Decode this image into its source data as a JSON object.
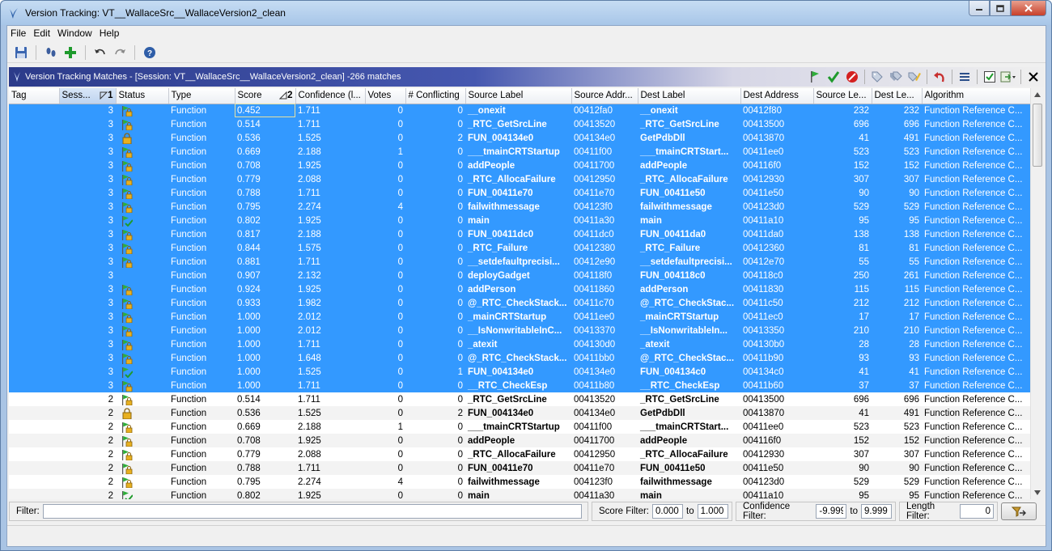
{
  "window": {
    "title": "Version Tracking: VT__WallaceSrc__WallaceVersion2_clean"
  },
  "menu": [
    "File",
    "Edit",
    "Window",
    "Help"
  ],
  "toolbar": {
    "icons": [
      "save-icon",
      "footsteps-icon",
      "add-icon",
      "undo-icon",
      "redo-icon",
      "help-icon"
    ]
  },
  "panel": {
    "title": "Version Tracking Matches - [Session: VT__WallaceSrc__WallaceVersion2_clean] -266 matches",
    "tools": [
      "accept-flag-icon",
      "checkmark-icon",
      "reject-icon",
      "tag-icon",
      "tags-icon",
      "edit-tag-icon",
      "undo-arrow-icon",
      "menu-lines-icon",
      "checkbox-icon",
      "export-icon",
      "close-icon"
    ]
  },
  "table": {
    "columns": [
      "Tag",
      "Sess...",
      "Status",
      "Type",
      "Score",
      "Confidence (l...",
      "Votes",
      "# Conflicting",
      "Source Label",
      "Source Addr...",
      "Dest Label",
      "Dest Address",
      "Source Le...",
      "Dest Le...",
      "Algorithm"
    ],
    "sort_markers": {
      "session": "1",
      "score": "2"
    },
    "rows": [
      {
        "tag": "",
        "session": "3",
        "status": "flag-lock",
        "type": "Function",
        "score": "0.452",
        "confidence": "1.711",
        "votes": "0",
        "conflicting": "0",
        "src_label": "__onexit",
        "src_addr": "00412fa0",
        "dst_label": "__onexit",
        "dst_addr": "00412f80",
        "src_len": "232",
        "dst_len": "232",
        "algorithm": "Function Reference C...",
        "state": "sel"
      },
      {
        "tag": "",
        "session": "3",
        "status": "flag-lock",
        "type": "Function",
        "score": "0.514",
        "confidence": "1.711",
        "votes": "0",
        "conflicting": "0",
        "src_label": "_RTC_GetSrcLine",
        "src_addr": "00413520",
        "dst_label": "_RTC_GetSrcLine",
        "dst_addr": "00413500",
        "src_len": "696",
        "dst_len": "696",
        "algorithm": "Function Reference C...",
        "state": "sel"
      },
      {
        "tag": "",
        "session": "3",
        "status": "lock",
        "type": "Function",
        "score": "0.536",
        "confidence": "1.525",
        "votes": "0",
        "conflicting": "2",
        "src_label": "FUN_004134e0",
        "src_addr": "004134e0",
        "dst_label": "GetPdbDll",
        "dst_addr": "00413870",
        "src_len": "41",
        "dst_len": "491",
        "algorithm": "Function Reference C...",
        "state": "sel"
      },
      {
        "tag": "",
        "session": "3",
        "status": "flag-lock",
        "type": "Function",
        "score": "0.669",
        "confidence": "2.188",
        "votes": "1",
        "conflicting": "0",
        "src_label": "___tmainCRTStartup",
        "src_addr": "00411f00",
        "dst_label": "___tmainCRTStart...",
        "dst_addr": "00411ee0",
        "src_len": "523",
        "dst_len": "523",
        "algorithm": "Function Reference C...",
        "state": "sel"
      },
      {
        "tag": "",
        "session": "3",
        "status": "flag-lock",
        "type": "Function",
        "score": "0.708",
        "confidence": "1.925",
        "votes": "0",
        "conflicting": "0",
        "src_label": "addPeople",
        "src_addr": "00411700",
        "dst_label": "addPeople",
        "dst_addr": "004116f0",
        "src_len": "152",
        "dst_len": "152",
        "algorithm": "Function Reference C...",
        "state": "sel"
      },
      {
        "tag": "",
        "session": "3",
        "status": "flag-lock",
        "type": "Function",
        "score": "0.779",
        "confidence": "2.088",
        "votes": "0",
        "conflicting": "0",
        "src_label": "_RTC_AllocaFailure",
        "src_addr": "00412950",
        "dst_label": "_RTC_AllocaFailure",
        "dst_addr": "00412930",
        "src_len": "307",
        "dst_len": "307",
        "algorithm": "Function Reference C...",
        "state": "sel"
      },
      {
        "tag": "",
        "session": "3",
        "status": "flag-lock",
        "type": "Function",
        "score": "0.788",
        "confidence": "1.711",
        "votes": "0",
        "conflicting": "0",
        "src_label": "FUN_00411e70",
        "src_addr": "00411e70",
        "dst_label": "FUN_00411e50",
        "dst_addr": "00411e50",
        "src_len": "90",
        "dst_len": "90",
        "algorithm": "Function Reference C...",
        "state": "sel"
      },
      {
        "tag": "",
        "session": "3",
        "status": "flag-lock",
        "type": "Function",
        "score": "0.795",
        "confidence": "2.274",
        "votes": "4",
        "conflicting": "0",
        "src_label": "failwithmessage",
        "src_addr": "004123f0",
        "dst_label": "failwithmessage",
        "dst_addr": "004123d0",
        "src_len": "529",
        "dst_len": "529",
        "algorithm": "Function Reference C...",
        "state": "sel"
      },
      {
        "tag": "",
        "session": "3",
        "status": "flag-check",
        "type": "Function",
        "score": "0.802",
        "confidence": "1.925",
        "votes": "0",
        "conflicting": "0",
        "src_label": "main",
        "src_addr": "00411a30",
        "dst_label": "main",
        "dst_addr": "00411a10",
        "src_len": "95",
        "dst_len": "95",
        "algorithm": "Function Reference C...",
        "state": "sel"
      },
      {
        "tag": "",
        "session": "3",
        "status": "flag-lock",
        "type": "Function",
        "score": "0.817",
        "confidence": "2.188",
        "votes": "0",
        "conflicting": "0",
        "src_label": "FUN_00411dc0",
        "src_addr": "00411dc0",
        "dst_label": "FUN_00411da0",
        "dst_addr": "00411da0",
        "src_len": "138",
        "dst_len": "138",
        "algorithm": "Function Reference C...",
        "state": "sel"
      },
      {
        "tag": "",
        "session": "3",
        "status": "flag-lock",
        "type": "Function",
        "score": "0.844",
        "confidence": "1.575",
        "votes": "0",
        "conflicting": "0",
        "src_label": "_RTC_Failure",
        "src_addr": "00412380",
        "dst_label": "_RTC_Failure",
        "dst_addr": "00412360",
        "src_len": "81",
        "dst_len": "81",
        "algorithm": "Function Reference C...",
        "state": "sel"
      },
      {
        "tag": "",
        "session": "3",
        "status": "flag-lock",
        "type": "Function",
        "score": "0.881",
        "confidence": "1.711",
        "votes": "0",
        "conflicting": "0",
        "src_label": "__setdefaultprecisi...",
        "src_addr": "00412e90",
        "dst_label": "__setdefaultprecisi...",
        "dst_addr": "00412e70",
        "src_len": "55",
        "dst_len": "55",
        "algorithm": "Function Reference C...",
        "state": "sel"
      },
      {
        "tag": "",
        "session": "3",
        "status": "none",
        "type": "Function",
        "score": "0.907",
        "confidence": "2.132",
        "votes": "0",
        "conflicting": "0",
        "src_label": "deployGadget",
        "src_addr": "004118f0",
        "dst_label": "FUN_004118c0",
        "dst_addr": "004118c0",
        "src_len": "250",
        "dst_len": "261",
        "algorithm": "Function Reference C...",
        "state": "sel"
      },
      {
        "tag": "",
        "session": "3",
        "status": "flag-lock",
        "type": "Function",
        "score": "0.924",
        "confidence": "1.925",
        "votes": "0",
        "conflicting": "0",
        "src_label": "addPerson",
        "src_addr": "00411860",
        "dst_label": "addPerson",
        "dst_addr": "00411830",
        "src_len": "115",
        "dst_len": "115",
        "algorithm": "Function Reference C...",
        "state": "sel"
      },
      {
        "tag": "",
        "session": "3",
        "status": "flag-lock",
        "type": "Function",
        "score": "0.933",
        "confidence": "1.982",
        "votes": "0",
        "conflicting": "0",
        "src_label": "@_RTC_CheckStack...",
        "src_addr": "00411c70",
        "dst_label": "@_RTC_CheckStac...",
        "dst_addr": "00411c50",
        "src_len": "212",
        "dst_len": "212",
        "algorithm": "Function Reference C...",
        "state": "sel"
      },
      {
        "tag": "",
        "session": "3",
        "status": "flag-lock",
        "type": "Function",
        "score": "1.000",
        "confidence": "2.012",
        "votes": "0",
        "conflicting": "0",
        "src_label": "_mainCRTStartup",
        "src_addr": "00411ee0",
        "dst_label": "_mainCRTStartup",
        "dst_addr": "00411ec0",
        "src_len": "17",
        "dst_len": "17",
        "algorithm": "Function Reference C...",
        "state": "sel"
      },
      {
        "tag": "",
        "session": "3",
        "status": "flag-lock",
        "type": "Function",
        "score": "1.000",
        "confidence": "2.012",
        "votes": "0",
        "conflicting": "0",
        "src_label": "__IsNonwritableInC...",
        "src_addr": "00413370",
        "dst_label": "__IsNonwritableIn...",
        "dst_addr": "00413350",
        "src_len": "210",
        "dst_len": "210",
        "algorithm": "Function Reference C...",
        "state": "sel"
      },
      {
        "tag": "",
        "session": "3",
        "status": "flag-lock",
        "type": "Function",
        "score": "1.000",
        "confidence": "1.711",
        "votes": "0",
        "conflicting": "0",
        "src_label": "_atexit",
        "src_addr": "004130d0",
        "dst_label": "_atexit",
        "dst_addr": "004130b0",
        "src_len": "28",
        "dst_len": "28",
        "algorithm": "Function Reference C...",
        "state": "sel"
      },
      {
        "tag": "",
        "session": "3",
        "status": "flag-lock",
        "type": "Function",
        "score": "1.000",
        "confidence": "1.648",
        "votes": "0",
        "conflicting": "0",
        "src_label": "@_RTC_CheckStack...",
        "src_addr": "00411bb0",
        "dst_label": "@_RTC_CheckStac...",
        "dst_addr": "00411b90",
        "src_len": "93",
        "dst_len": "93",
        "algorithm": "Function Reference C...",
        "state": "sel"
      },
      {
        "tag": "",
        "session": "3",
        "status": "flag-check",
        "type": "Function",
        "score": "1.000",
        "confidence": "1.525",
        "votes": "0",
        "conflicting": "1",
        "src_label": "FUN_004134e0",
        "src_addr": "004134e0",
        "dst_label": "FUN_004134c0",
        "dst_addr": "004134c0",
        "src_len": "41",
        "dst_len": "41",
        "algorithm": "Function Reference C...",
        "state": "sel"
      },
      {
        "tag": "",
        "session": "3",
        "status": "flag-lock",
        "type": "Function",
        "score": "1.000",
        "confidence": "1.711",
        "votes": "0",
        "conflicting": "0",
        "src_label": "__RTC_CheckEsp",
        "src_addr": "00411b80",
        "dst_label": "__RTC_CheckEsp",
        "dst_addr": "00411b60",
        "src_len": "37",
        "dst_len": "37",
        "algorithm": "Function Reference C...",
        "state": "sel"
      },
      {
        "tag": "",
        "session": "2",
        "status": "flag-lock",
        "type": "Function",
        "score": "0.514",
        "confidence": "1.711",
        "votes": "0",
        "conflicting": "0",
        "src_label": "_RTC_GetSrcLine",
        "src_addr": "00413520",
        "dst_label": "_RTC_GetSrcLine",
        "dst_addr": "00413500",
        "src_len": "696",
        "dst_len": "696",
        "algorithm": "Function Reference C...",
        "state": "plain"
      },
      {
        "tag": "",
        "session": "2",
        "status": "lock",
        "type": "Function",
        "score": "0.536",
        "confidence": "1.525",
        "votes": "0",
        "conflicting": "2",
        "src_label": "FUN_004134e0",
        "src_addr": "004134e0",
        "dst_label": "GetPdbDll",
        "dst_addr": "00413870",
        "src_len": "41",
        "dst_len": "491",
        "algorithm": "Function Reference C...",
        "state": "alt"
      },
      {
        "tag": "",
        "session": "2",
        "status": "flag-lock",
        "type": "Function",
        "score": "0.669",
        "confidence": "2.188",
        "votes": "1",
        "conflicting": "0",
        "src_label": "___tmainCRTStartup",
        "src_addr": "00411f00",
        "dst_label": "___tmainCRTStart...",
        "dst_addr": "00411ee0",
        "src_len": "523",
        "dst_len": "523",
        "algorithm": "Function Reference C...",
        "state": "plain"
      },
      {
        "tag": "",
        "session": "2",
        "status": "flag-lock",
        "type": "Function",
        "score": "0.708",
        "confidence": "1.925",
        "votes": "0",
        "conflicting": "0",
        "src_label": "addPeople",
        "src_addr": "00411700",
        "dst_label": "addPeople",
        "dst_addr": "004116f0",
        "src_len": "152",
        "dst_len": "152",
        "algorithm": "Function Reference C...",
        "state": "alt"
      },
      {
        "tag": "",
        "session": "2",
        "status": "flag-lock",
        "type": "Function",
        "score": "0.779",
        "confidence": "2.088",
        "votes": "0",
        "conflicting": "0",
        "src_label": "_RTC_AllocaFailure",
        "src_addr": "00412950",
        "dst_label": "_RTC_AllocaFailure",
        "dst_addr": "00412930",
        "src_len": "307",
        "dst_len": "307",
        "algorithm": "Function Reference C...",
        "state": "plain"
      },
      {
        "tag": "",
        "session": "2",
        "status": "flag-lock",
        "type": "Function",
        "score": "0.788",
        "confidence": "1.711",
        "votes": "0",
        "conflicting": "0",
        "src_label": "FUN_00411e70",
        "src_addr": "00411e70",
        "dst_label": "FUN_00411e50",
        "dst_addr": "00411e50",
        "src_len": "90",
        "dst_len": "90",
        "algorithm": "Function Reference C...",
        "state": "alt"
      },
      {
        "tag": "",
        "session": "2",
        "status": "flag-lock",
        "type": "Function",
        "score": "0.795",
        "confidence": "2.274",
        "votes": "4",
        "conflicting": "0",
        "src_label": "failwithmessage",
        "src_addr": "004123f0",
        "dst_label": "failwithmessage",
        "dst_addr": "004123d0",
        "src_len": "529",
        "dst_len": "529",
        "algorithm": "Function Reference C...",
        "state": "plain"
      },
      {
        "tag": "",
        "session": "2",
        "status": "flag-check",
        "type": "Function",
        "score": "0.802",
        "confidence": "1.925",
        "votes": "0",
        "conflicting": "0",
        "src_label": "main",
        "src_addr": "00411a30",
        "dst_label": "main",
        "dst_addr": "00411a10",
        "src_len": "95",
        "dst_len": "95",
        "algorithm": "Function Reference C...",
        "state": "alt"
      }
    ]
  },
  "filters": {
    "filter_label": "Filter:",
    "filter_value": "",
    "score_label": "Score Filter:",
    "score_min": "0.000",
    "score_to": "to",
    "score_max": "1.000",
    "confidence_label": "Confidence Filter:",
    "confidence_min": "-9.999",
    "confidence_to": "to",
    "confidence_max": "9.999",
    "length_label": "Length Filter:",
    "length_value": "0"
  },
  "colors": {
    "selection": "#3399ff",
    "header_gradient_start": "#2c3b8a",
    "alt_row": "#f3f3f3"
  }
}
